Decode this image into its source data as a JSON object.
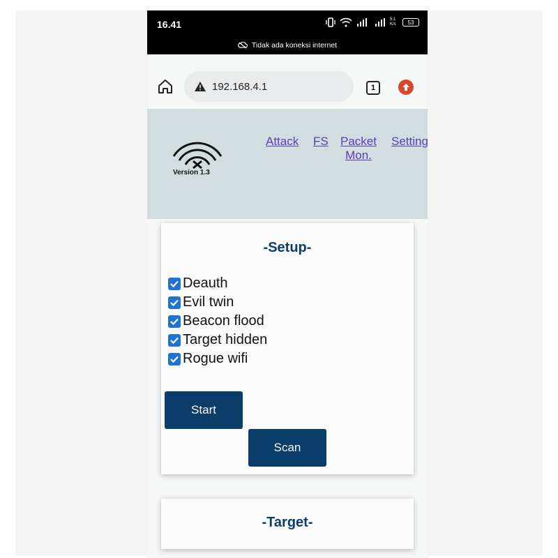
{
  "status_bar": {
    "time": "16.41",
    "network_speed": "5.1 K/s",
    "battery": "53",
    "network_notice": "Tidak ada koneksi internet"
  },
  "browser": {
    "url": "192.168.4.1",
    "tab_count": "1"
  },
  "header": {
    "version": "Version 1.3",
    "nav": {
      "attack": "Attack",
      "fs": "FS",
      "packet_line1": "Packet",
      "packet_line2": "Mon.",
      "settings": "Setting"
    }
  },
  "setup": {
    "title": "-Setup-",
    "options": [
      {
        "label": "Deauth",
        "checked": true
      },
      {
        "label": "Evil twin",
        "checked": true
      },
      {
        "label": "Beacon flood",
        "checked": true
      },
      {
        "label": "Target hidden",
        "checked": true
      },
      {
        "label": "Rogue wifi",
        "checked": true
      }
    ],
    "start_label": "Start",
    "scan_label": "Scan"
  },
  "target": {
    "title": "-Target-"
  },
  "colors": {
    "primary": "#0b3d6b",
    "link": "#5a3eb8",
    "checkbox": "#1f73d2",
    "header_bg": "#d3dcdf"
  }
}
